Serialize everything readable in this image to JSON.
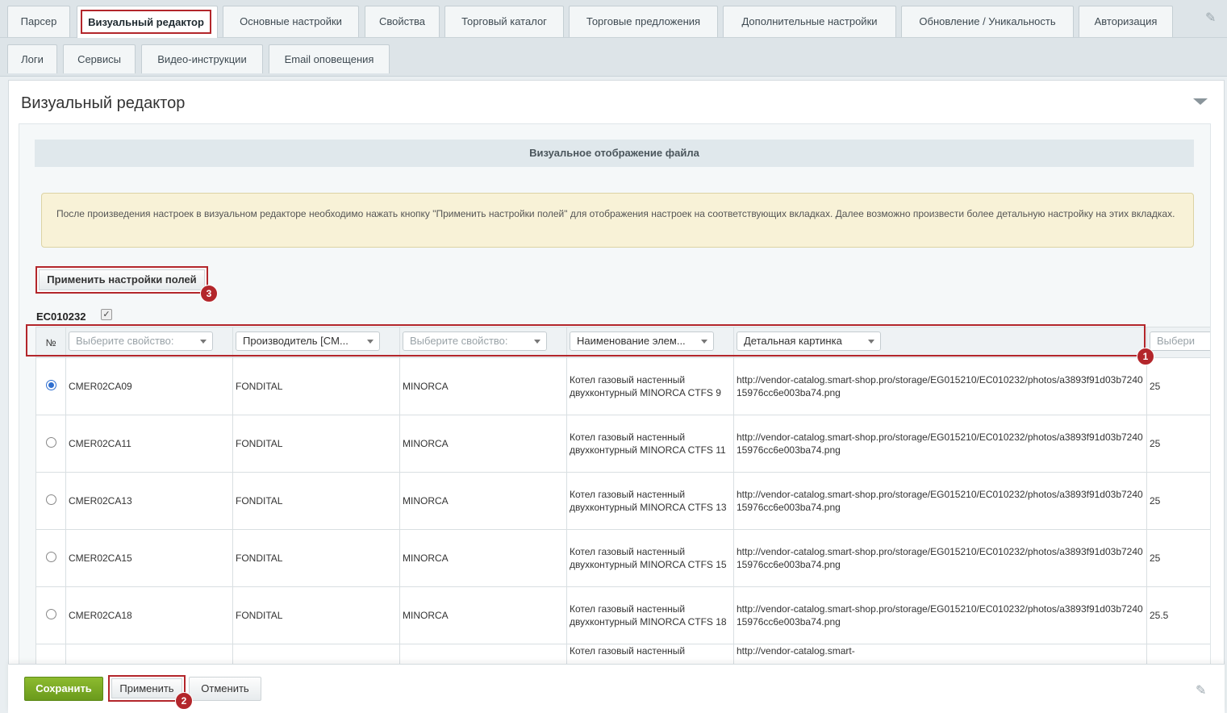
{
  "tabs_row1": [
    {
      "label": "Парсер"
    },
    {
      "label": "Визуальный редактор"
    },
    {
      "label": "Основные настройки"
    },
    {
      "label": "Свойства"
    },
    {
      "label": "Торговый каталог"
    },
    {
      "label": "Торговые предложения"
    },
    {
      "label": "Дополнительные настройки"
    },
    {
      "label": "Обновление / Уникальность"
    },
    {
      "label": "Авторизация"
    }
  ],
  "tabs_row2": [
    {
      "label": "Логи"
    },
    {
      "label": "Сервисы"
    },
    {
      "label": "Видео-инструкции"
    },
    {
      "label": "Email оповещения"
    }
  ],
  "panel": {
    "title": "Визуальный редактор",
    "section_title": "Визуальное отображение файла",
    "notice": "После произведения настроек в визуальном редакторе необходимо нажать кнопку \"Применить настройки полей\" для отображения настроек на соответствующих вкладках. Далее возможно произвести более детальную настройку на этих вкладках.",
    "apply_fields_label": "Применить настройки полей",
    "file_code": "EC010232",
    "file_checkbox": "✓"
  },
  "badges": {
    "b1": "1",
    "b2": "2",
    "b3": "3"
  },
  "table": {
    "num_header": "№",
    "selects": [
      {
        "value": "Выберите свойство:"
      },
      {
        "value": "Производитель [CM..."
      },
      {
        "value": "Выберите свойство:"
      },
      {
        "value": "Наименование элем..."
      },
      {
        "value": "Детальная картинка"
      },
      {
        "value": "Выбери"
      }
    ],
    "rows": [
      {
        "code": "CMER02CA09",
        "brand": "FONDITAL",
        "series": "MINORCA",
        "name": "Котел газовый настенный двухконтурный MINORCA CTFS 9",
        "image": "http://vendor-catalog.smart-shop.pro/storage/EG015210/EC010232/photos/a3893f91d03b724015976cc6e003ba74.png",
        "value": "25"
      },
      {
        "code": "CMER02CA11",
        "brand": "FONDITAL",
        "series": "MINORCA",
        "name": "Котел газовый настенный двухконтурный MINORCA CTFS 11",
        "image": "http://vendor-catalog.smart-shop.pro/storage/EG015210/EC010232/photos/a3893f91d03b724015976cc6e003ba74.png",
        "value": "25"
      },
      {
        "code": "CMER02CA13",
        "brand": "FONDITAL",
        "series": "MINORCA",
        "name": "Котел газовый настенный двухконтурный MINORCA CTFS 13",
        "image": "http://vendor-catalog.smart-shop.pro/storage/EG015210/EC010232/photos/a3893f91d03b724015976cc6e003ba74.png",
        "value": "25"
      },
      {
        "code": "CMER02CA15",
        "brand": "FONDITAL",
        "series": "MINORCA",
        "name": "Котел газовый настенный двухконтурный MINORCA CTFS 15",
        "image": "http://vendor-catalog.smart-shop.pro/storage/EG015210/EC010232/photos/a3893f91d03b724015976cc6e003ba74.png",
        "value": "25"
      },
      {
        "code": "CMER02CA18",
        "brand": "FONDITAL",
        "series": "MINORCA",
        "name": "Котел газовый настенный двухконтурный MINORCA CTFS 18",
        "image": "http://vendor-catalog.smart-shop.pro/storage/EG015210/EC010232/photos/a3893f91d03b724015976cc6e003ba74.png",
        "value": "25.5"
      },
      {
        "code": "",
        "brand": "",
        "series": "",
        "name": "Котел газовый настенный",
        "image": "http://vendor-catalog.smart-",
        "value": ""
      }
    ]
  },
  "footer": {
    "save_label": "Сохранить",
    "apply_label": "Применить",
    "cancel_label": "Отменить"
  },
  "colors": {
    "accent_red": "#b3262b",
    "save_green": "#7aaa24",
    "radio_blue": "#2f6fd0"
  }
}
